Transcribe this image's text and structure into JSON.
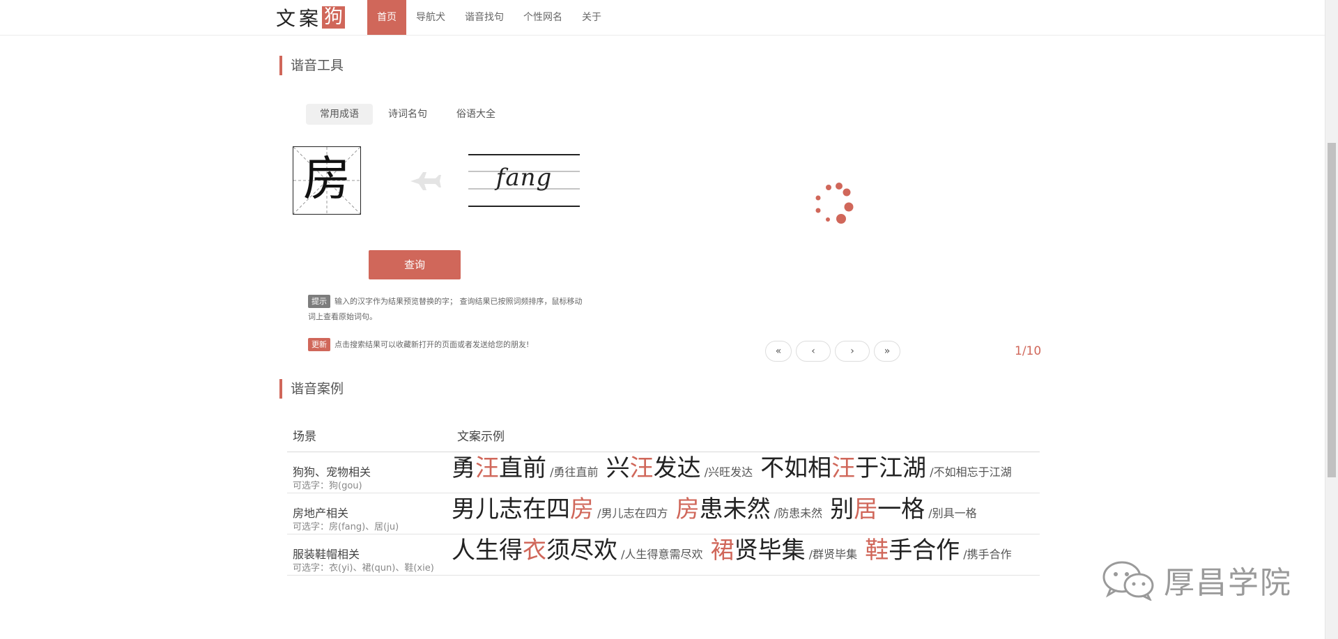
{
  "logo": {
    "text_plain": "文案",
    "text_boxed": "狗"
  },
  "nav": {
    "items": [
      {
        "label": "首页",
        "active": true
      },
      {
        "label": "导航犬",
        "active": false
      },
      {
        "label": "谐音找句",
        "active": false
      },
      {
        "label": "个性网名",
        "active": false
      },
      {
        "label": "关于",
        "active": false
      }
    ]
  },
  "tool": {
    "title": "谐音工具",
    "tabs": [
      {
        "label": "常用成语",
        "active": true
      },
      {
        "label": "诗词名句",
        "active": false
      },
      {
        "label": "俗语大全",
        "active": false
      }
    ],
    "input_char": "房",
    "pinyin": "fang",
    "query_button": "查询",
    "tip_badge": "提示",
    "tip_text": "输入的汉字作为结果预览替换的字； 查询结果已按照词频排序，鼠标移动词上查看原始词句。",
    "update_badge": "更新",
    "update_text": "点击搜索结果可以收藏新打开的页面或者发送给您的朋友!",
    "pager": {
      "first": "«",
      "prev": "‹",
      "next": "›",
      "last": "»",
      "count": "1/10"
    }
  },
  "cases": {
    "title": "谐音案例",
    "col_scene": "场景",
    "col_example": "文案示例",
    "rows": [
      {
        "scene": "狗狗、宠物相关",
        "options": "可选字：狗(gou)",
        "phrases": [
          {
            "pre": "勇",
            "hl": "汪",
            "post": "直前",
            "orig": "/勇往直前"
          },
          {
            "pre": "兴",
            "hl": "汪",
            "post": "发达",
            "orig": "/兴旺发达"
          },
          {
            "pre": "不如相",
            "hl": "汪",
            "post": "于江湖",
            "orig": "/不如相忘于江湖"
          }
        ]
      },
      {
        "scene": "房地产相关",
        "options": "可选字：房(fang)、居(ju)",
        "phrases": [
          {
            "pre": "男儿志在四",
            "hl": "房",
            "post": "",
            "orig": "/男儿志在四方"
          },
          {
            "pre": "",
            "hl": "房",
            "post": "患未然",
            "orig": "/防患未然"
          },
          {
            "pre": "别",
            "hl": "居",
            "post": "一格",
            "orig": "/别具一格"
          }
        ]
      },
      {
        "scene": "服装鞋帽相关",
        "options": "可选字：衣(yi)、裙(qun)、鞋(xie)",
        "phrases": [
          {
            "pre": "人生得",
            "hl": "衣",
            "post": "须尽欢",
            "orig": "/人生得意需尽欢"
          },
          {
            "pre": "",
            "hl": "裙",
            "post": "贤毕集",
            "orig": "/群贤毕集"
          },
          {
            "pre": "",
            "hl": "鞋",
            "post": "手合作",
            "orig": "/携手合作"
          }
        ]
      }
    ]
  },
  "watermark": {
    "text": "厚昌学院",
    "icon": "wechat-icon"
  },
  "colors": {
    "accent": "#d0675a",
    "tip_badge": "#7d7d7d"
  }
}
